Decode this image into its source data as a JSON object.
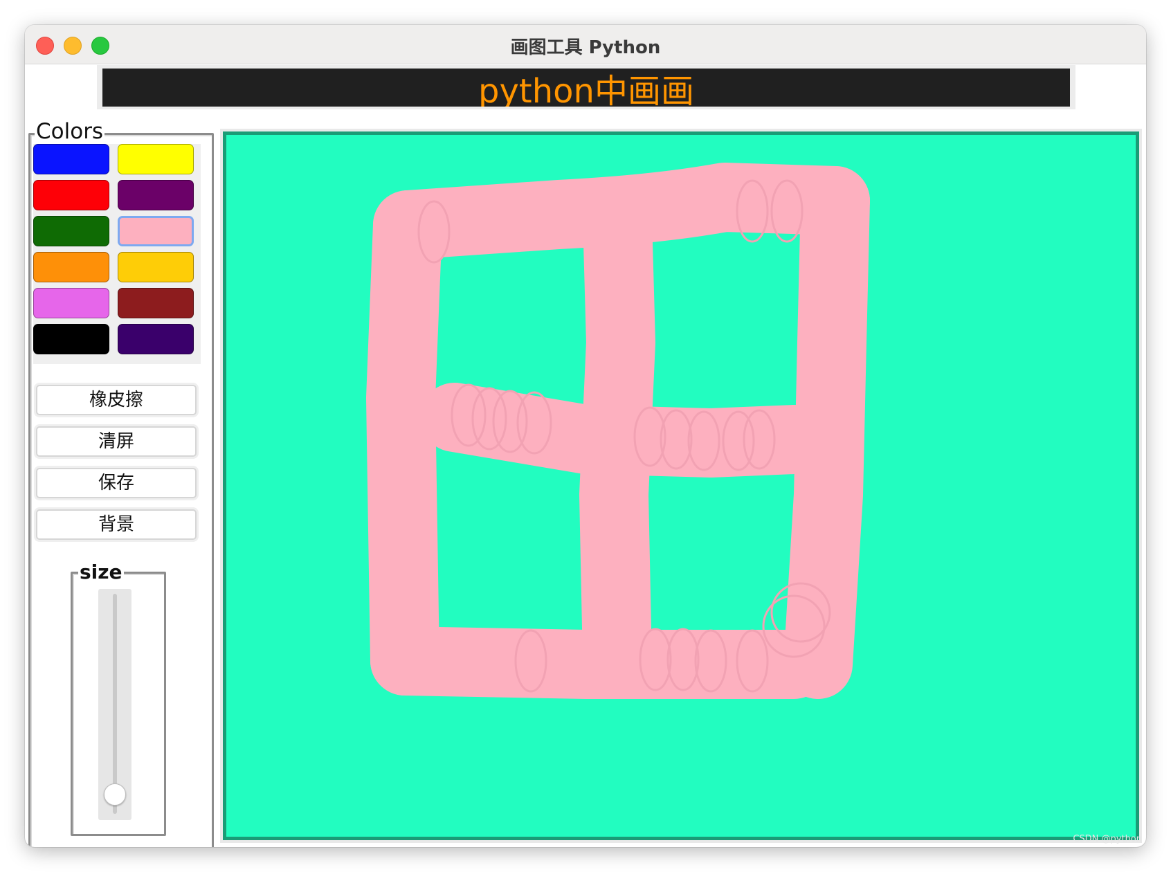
{
  "window": {
    "title": "画图工具 Python"
  },
  "banner": {
    "text": "python中画画"
  },
  "colors_panel": {
    "legend": "Colors",
    "swatches": [
      {
        "name": "blue",
        "color": "#0a14ff"
      },
      {
        "name": "yellow",
        "color": "#ffff00"
      },
      {
        "name": "red",
        "color": "#fe0007"
      },
      {
        "name": "purple",
        "color": "#6b0168"
      },
      {
        "name": "green",
        "color": "#0f6b04"
      },
      {
        "name": "pink",
        "color": "#fdb0bf",
        "selected": true
      },
      {
        "name": "orange",
        "color": "#fe9008"
      },
      {
        "name": "gold",
        "color": "#fecd07"
      },
      {
        "name": "violet",
        "color": "#e666ea"
      },
      {
        "name": "dark-red",
        "color": "#8d1c1e"
      },
      {
        "name": "black",
        "color": "#000000"
      },
      {
        "name": "indigo",
        "color": "#3a006b"
      }
    ]
  },
  "buttons": {
    "eraser": "橡皮擦",
    "clear": "清屏",
    "save": "保存",
    "background": "背景"
  },
  "size_scale": {
    "legend": "size",
    "value_fraction": 0.95
  },
  "canvas": {
    "background_color": "#22fdc0",
    "border_color": "#1a9c76",
    "stroke_color": "#fdb0bf",
    "drawing": "田"
  },
  "watermark": "CSDN @python"
}
